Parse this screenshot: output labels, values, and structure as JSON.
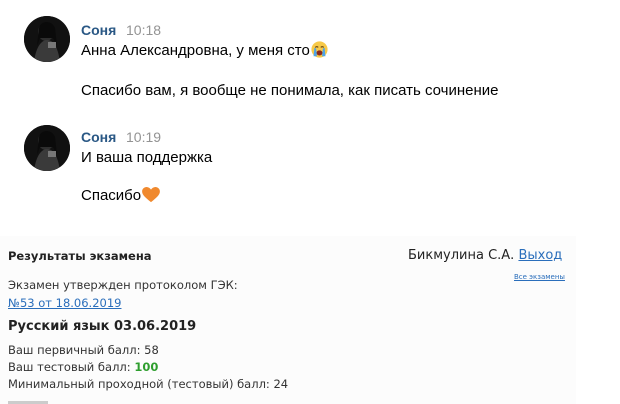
{
  "messages": [
    {
      "author": "Соня",
      "time": "10:18",
      "lines": [
        "Анна Александровна, у меня сто",
        "Спасибо вам, я вообще не понимала, как писать сочинение"
      ],
      "emoji": "crying-face-icon"
    },
    {
      "author": "Соня",
      "time": "10:19",
      "lines": [
        "И ваша поддержка",
        "Спасибо"
      ],
      "emoji": "orange-heart-icon"
    }
  ],
  "exam": {
    "title": "Результаты экзамена",
    "user": "Бикмулина С.А.",
    "logout": "Выход",
    "all_exams": "Все экзамены",
    "approved_text": "Экзамен утвержден протоколом ГЭК:",
    "protocol_link": "№53 от 18.06.2019",
    "subject": "Русский язык 03.06.2019",
    "primary_label": "Ваш первичный балл:",
    "primary_value": "58",
    "test_label": "Ваш тестовый балл:",
    "test_value": "100",
    "min_label": "Минимальный проходной (тестовый) балл:",
    "min_value": "24"
  },
  "colors": {
    "author": "#2a5885",
    "time": "#939393",
    "link": "#2a6ebb",
    "score": "#2e9e2e"
  }
}
